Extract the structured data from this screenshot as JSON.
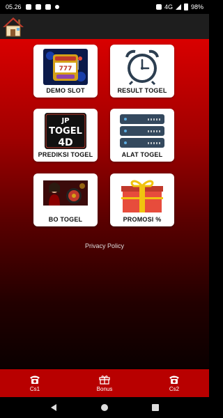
{
  "status_bar": {
    "time": "05.26",
    "network": "4G",
    "battery": "98%"
  },
  "menu": [
    {
      "label": "DEMO SLOT",
      "icon": "slot-machine-icon"
    },
    {
      "label": "RESULT TOGEL",
      "icon": "alarm-clock-icon"
    },
    {
      "label": "PREDIKSI TOGEL",
      "icon": "jp-togel-4d-logo",
      "logo_text": [
        "JP",
        "TOGEL",
        "4D"
      ]
    },
    {
      "label": "ALAT TOGEL",
      "icon": "server-stack-icon"
    },
    {
      "label": "BO TOGEL",
      "icon": "casino-photo"
    },
    {
      "label": "PROMOSI %",
      "icon": "gift-box-icon"
    }
  ],
  "privacy_label": "Privacy Policy",
  "bottom_nav": [
    {
      "label": "Cs1",
      "icon": "phone-icon"
    },
    {
      "label": "Bonus",
      "icon": "gift-icon"
    },
    {
      "label": "Cs2",
      "icon": "phone-icon"
    }
  ],
  "colors": {
    "accent": "#b80000",
    "gradient_top": "#d90000",
    "card_bg": "#ffffff"
  }
}
